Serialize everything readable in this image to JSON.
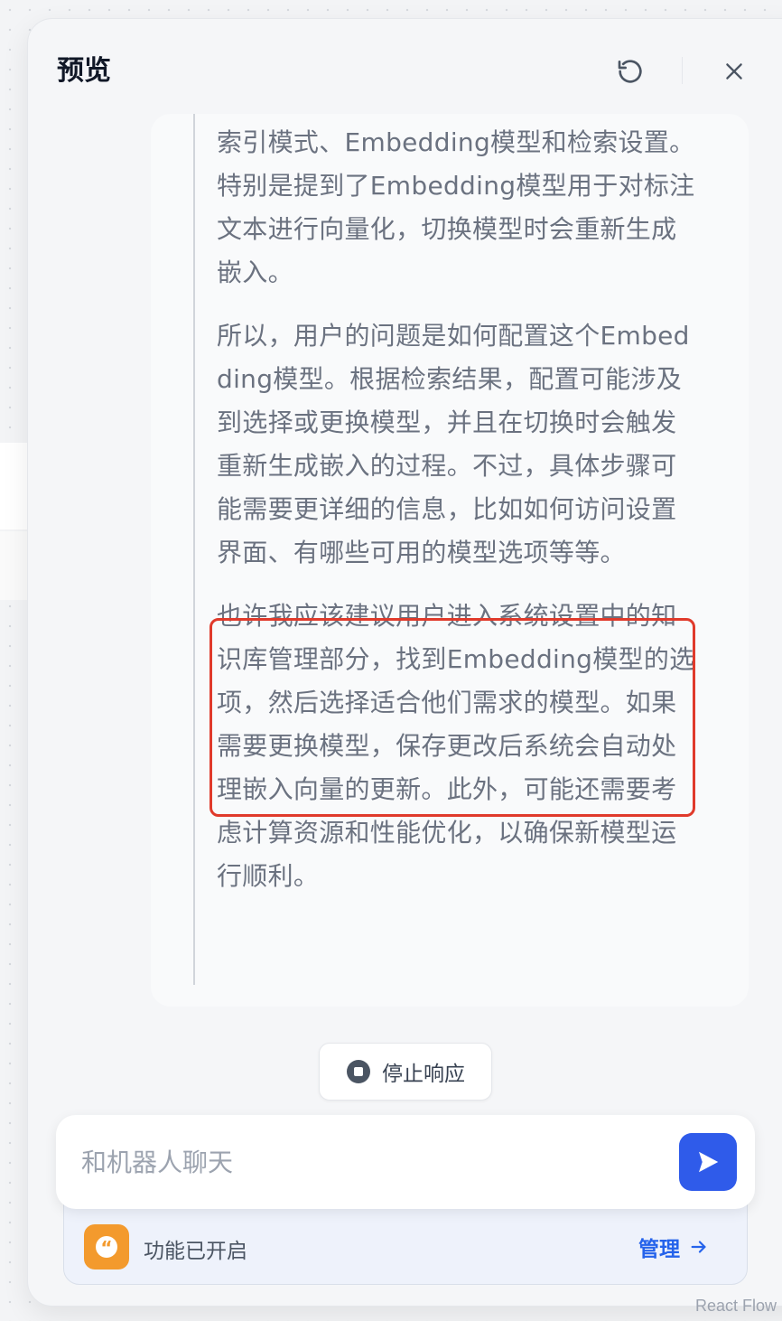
{
  "panel": {
    "title": "预览"
  },
  "message": {
    "paragraphs": [
      "索引模式、Embedding模型和检索设置。特别是提到了Embedding模型用于对标注文本进行向量化，切换模型时会重新生成嵌入。",
      "所以，用户的问题是如何配置这个Embedding模型。根据检索结果，配置可能涉及到选择或更换模型，并且在切换时会触发重新生成嵌入的过程。不过，具体步骤可能需要更详细的信息，比如如何访问设置界面、有哪些可用的模型选项等等。",
      "也许我应该建议用户进入系统设置中的知识库管理部分，找到Embedding模型的选项，然后选择适合他们需求的模型。如果需要更换模型，保存更改后系统会自动处理嵌入向量的更新。此外，可能还需要考虑计算资源和性能优化，以确保新模型运行顺利。"
    ]
  },
  "stop": {
    "label": "停止响应"
  },
  "chat": {
    "placeholder": "和机器人聊天",
    "value": ""
  },
  "features": {
    "text": "功能已开启",
    "manage_label": "管理"
  },
  "footer": {
    "watermark": "React Flow"
  },
  "colors": {
    "accent": "#2f5bea",
    "highlight": "#e03a2b",
    "feature_icon": "#f39a2d"
  },
  "icons": {
    "refresh": "refresh-icon",
    "close": "close-icon",
    "stop": "stop-circle-icon",
    "send": "send-icon",
    "quote": "quote-icon",
    "arrow": "arrow-right-icon"
  }
}
